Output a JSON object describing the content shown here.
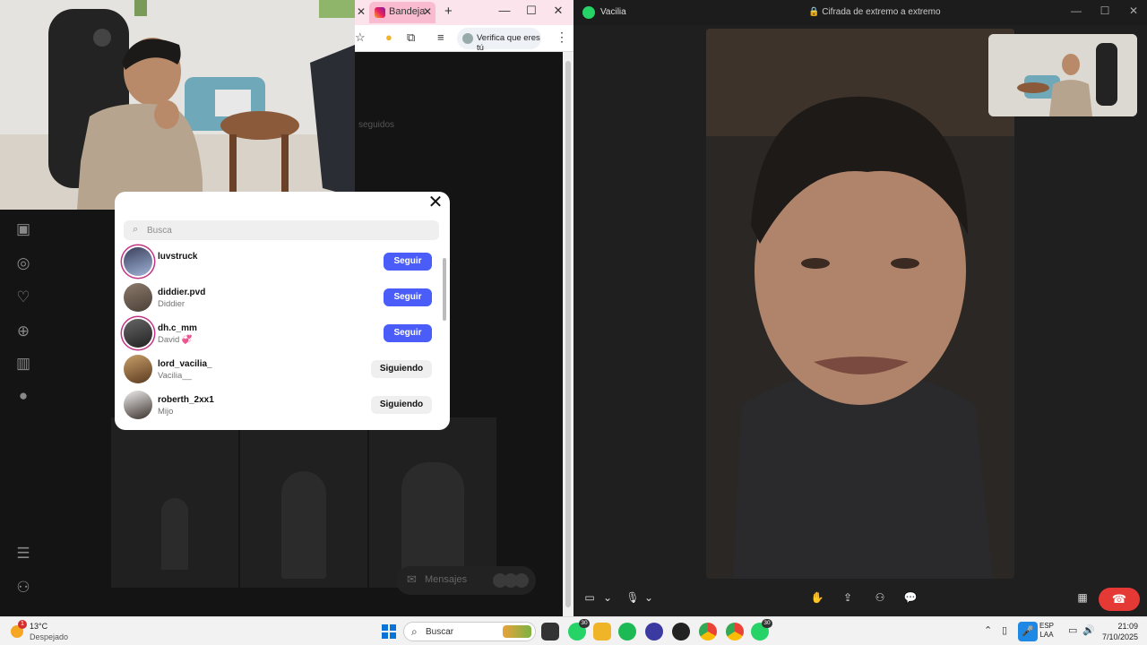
{
  "browser": {
    "tab_title": "Bandeja",
    "verify_chip": "Verifica que eres tú",
    "background_text": "seguidos",
    "messages_pill": "Mensajes"
  },
  "modal": {
    "search_placeholder": "Busca",
    "users": [
      {
        "username": "luvstruck",
        "fullname": "",
        "button": "Seguir"
      },
      {
        "username": "diddier.pvd",
        "fullname": "Diddier",
        "button": "Seguir"
      },
      {
        "username": "dh.c_mm",
        "fullname": "David 💞",
        "button": "Seguir"
      },
      {
        "username": "lord_vacilia_",
        "fullname": "Vacilia__",
        "button": "Siguiendo"
      },
      {
        "username": "roberth_2xx1",
        "fullname": "Mijo",
        "button": "Siguiendo"
      }
    ]
  },
  "whatsapp": {
    "contact": "Vacilia",
    "encryption": "Cifrada de extremo a extremo"
  },
  "taskbar": {
    "weather_alert": "1",
    "temperature": "13°C",
    "condition": "Despejado",
    "search": "Buscar",
    "lang_top": "ESP",
    "lang_bottom": "LAA",
    "time": "21:09",
    "date": "7/10/2025",
    "badges": {
      "whatsapp_a": "30",
      "whatsapp_b": "30"
    }
  },
  "colors": {
    "primary_button": "#4a5df9",
    "end_call": "#e53935",
    "whatsapp": "#25d366"
  }
}
